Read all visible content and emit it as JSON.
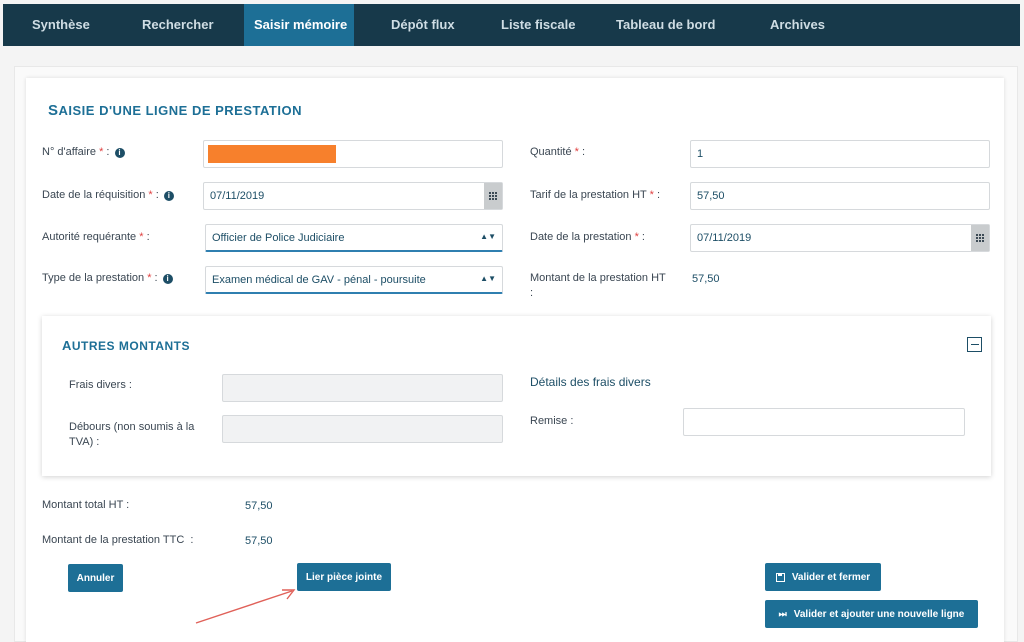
{
  "nav": {
    "items": [
      {
        "label": "Synthèse"
      },
      {
        "label": "Rechercher"
      },
      {
        "label": "Saisir mémoire",
        "active": true
      },
      {
        "label": "Dépôt flux"
      },
      {
        "label": "Liste fiscale"
      },
      {
        "label": "Tableau de bord"
      },
      {
        "label": "Archives"
      }
    ]
  },
  "form": {
    "title_initial": "S",
    "title_rest": "AISIE D'UNE LIGNE DE PRESTATION",
    "no_affaire_label": "N° d'affaire",
    "date_requisition_label": "Date de la réquisition",
    "date_requisition_value": "07/11/2019",
    "autorite_label": "Autorité requérante",
    "autorite_value": "Officier de Police Judiciaire",
    "type_label": "Type de la prestation",
    "type_value": "Examen médical de GAV - pénal - poursuite",
    "quantite_label": "Quantité",
    "quantite_value": "1",
    "tarif_label": "Tarif de la prestation HT",
    "tarif_value": "57,50",
    "date_prestation_label": "Date de la prestation",
    "date_prestation_value": "07/11/2019",
    "montant_label": "Montant de la prestation HT :",
    "montant_value": "57,50",
    "required_mark": "*",
    "colon": " :"
  },
  "autres": {
    "title_initial": "A",
    "title_rest": "UTRES MONTANTS",
    "frais_divers_label": "Frais divers :",
    "debours_label": "Débours (non soumis à la TVA) :",
    "details_label": "Détails des frais divers",
    "remise_label": "Remise :"
  },
  "totals": {
    "total_ht_label": "Montant total HT :",
    "total_ht_value": "57,50",
    "ttc_label": "Montant de la prestation TTC  :",
    "ttc_value": "57,50"
  },
  "buttons": {
    "annuler": "Annuler",
    "lier": "Lier pièce jointe",
    "valider_fermer": "Valider et fermer",
    "valider_ajouter": "Valider et ajouter une nouvelle ligne"
  },
  "icons": {
    "info": "i",
    "select_arrows": "▲▼"
  },
  "colors": {
    "nav_bg": "#17394a",
    "accent": "#1d6f96",
    "redaction": "#f7802c",
    "annotation_arrow": "#e06058"
  }
}
